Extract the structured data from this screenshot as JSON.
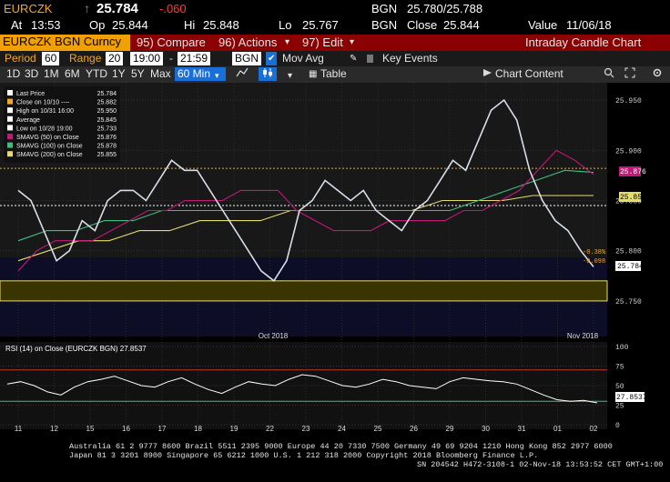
{
  "header": {
    "ticker": "EURCZK",
    "arrow": "↑",
    "last": "25.784",
    "change": "-.060",
    "at_label": "At",
    "at": "13:53",
    "op_label": "Op",
    "open": "25.844",
    "hi_label": "Hi",
    "high": "25.848",
    "lo_label": "Lo",
    "low": "25.767",
    "src1": "BGN",
    "bidask": "25.780/25.788",
    "src2": "BGN",
    "close_label": "Close",
    "close": "25.844",
    "value_label": "Value",
    "value_date": "11/06/18"
  },
  "toolbar": {
    "security": "EURCZK BGN Curncy",
    "compare": "95) Compare",
    "actions": "96) Actions",
    "edit": "97) Edit",
    "title": "Intraday Candle Chart"
  },
  "range_bar": {
    "period_label": "Period",
    "period": "60",
    "range_label": "Range",
    "range": "20",
    "from": "19:00",
    "dash": "-",
    "to": "21:59",
    "source": "BGN",
    "mov_avg": "Mov Avg",
    "key_events": "Key Events"
  },
  "tabs": {
    "items": [
      "1D",
      "3D",
      "1M",
      "6M",
      "YTD",
      "1Y",
      "5Y",
      "Max"
    ],
    "interval": "60 Min",
    "table": "Table",
    "chart_content": "Chart Content"
  },
  "legend": {
    "items": [
      {
        "label": "Last Price",
        "value": "25.784",
        "color": "#ffffff"
      },
      {
        "label": "Close on 10/10 ----",
        "value": "25.882",
        "color": "#f5a623"
      },
      {
        "label": "High on 10/31 16:00",
        "value": "25.950",
        "color": "#ffffff"
      },
      {
        "label": "Average",
        "value": "25.845",
        "color": "#ffffff"
      },
      {
        "label": "Low on 10/28 19:00",
        "value": "25.733",
        "color": "#ffffff"
      },
      {
        "label": "SMAVG (50)  on Close",
        "value": "25.876",
        "color": "#c2187a"
      },
      {
        "label": "SMAVG (100) on Close",
        "value": "25.878",
        "color": "#3fbf7f"
      },
      {
        "label": "SMAVG (200) on Close",
        "value": "25.855",
        "color": "#e6dc6e"
      }
    ],
    "rsi": "RSI (14)  on Close (EURCZK BGN) 27.8537"
  },
  "annotations": {
    "pct": "-0.38%",
    "chg": "-0.098",
    "price_last": "25.784",
    "price_50": "25.876",
    "price_200": "25.855",
    "rsi_last": "27.8537"
  },
  "footer": {
    "line1": "Australia 61 2 9777 8600 Brazil 5511 2395 9000 Europe 44 20 7330 7500 Germany 49 69 9204 1210 Hong Kong 852 2977 6000",
    "line2": "Japan 81 3 3201 8900        Singapore 65 6212 1000        U.S. 1 212 318 2000            Copyright 2018 Bloomberg Finance L.P.",
    "line3": "SN 204542 H472-3108-1 02-Nov-18 13:53:52 CET  GMT+1:00"
  },
  "chart_data": [
    {
      "type": "line",
      "title": "Intraday Candle Chart",
      "x_labels": [
        "11",
        "12",
        "15",
        "16",
        "17",
        "18",
        "19",
        "22",
        "23",
        "24",
        "25",
        "26",
        "29",
        "30",
        "31",
        "01",
        "02"
      ],
      "x_group_labels": [
        "Oct 2018",
        "Nov 2018"
      ],
      "ylim": [
        25.73,
        25.96
      ],
      "y_ticks": [
        25.75,
        25.8,
        25.85,
        25.9,
        25.95
      ],
      "y_tick_labels": [
        "25.750",
        "25.800",
        "25.850",
        "25.900",
        "25.950"
      ],
      "series": [
        {
          "name": "Last Price",
          "color": "#d8dee8",
          "values": [
            25.86,
            25.85,
            25.82,
            25.79,
            25.8,
            25.83,
            25.82,
            25.85,
            25.86,
            25.86,
            25.85,
            25.87,
            25.89,
            25.88,
            25.88,
            25.86,
            25.84,
            25.82,
            25.8,
            25.78,
            25.77,
            25.79,
            25.84,
            25.85,
            25.87,
            25.86,
            25.85,
            25.86,
            25.84,
            25.83,
            25.82,
            25.84,
            25.85,
            25.87,
            25.89,
            25.88,
            25.91,
            25.94,
            25.95,
            25.93,
            25.88,
            25.85,
            25.83,
            25.82,
            25.8,
            25.784
          ]
        },
        {
          "name": "SMAVG (50)",
          "color": "#c2187a",
          "values": [
            25.78,
            25.8,
            25.81,
            25.81,
            25.81,
            25.82,
            25.83,
            25.84,
            25.84,
            25.85,
            25.85,
            25.85,
            25.86,
            25.86,
            25.86,
            25.84,
            25.83,
            25.82,
            25.82,
            25.82,
            25.83,
            25.83,
            25.83,
            25.83,
            25.84,
            25.84,
            25.85,
            25.86,
            25.88,
            25.9,
            25.89,
            25.876
          ]
        },
        {
          "name": "SMAVG (100)",
          "color": "#3fbf7f",
          "values": [
            25.81,
            25.82,
            25.82,
            25.83,
            25.83,
            25.84,
            25.84,
            25.84,
            25.84,
            25.84,
            25.84,
            25.84,
            25.84,
            25.84,
            25.84,
            25.84,
            25.85,
            25.86,
            25.87,
            25.88,
            25.878
          ]
        },
        {
          "name": "SMAVG (200)",
          "color": "#e6dc6e",
          "values": [
            25.79,
            25.8,
            25.81,
            25.81,
            25.82,
            25.82,
            25.83,
            25.83,
            25.83,
            25.84,
            25.84,
            25.84,
            25.84,
            25.84,
            25.85,
            25.85,
            25.85,
            25.855,
            25.855,
            25.855
          ]
        }
      ],
      "reference_lines": [
        {
          "name": "Close on 10/10",
          "value": 25.882,
          "color": "#f5a623"
        },
        {
          "name": "Average",
          "value": 25.845,
          "color": "#ffffff"
        }
      ],
      "band": {
        "from": 25.75,
        "to": 25.77,
        "color": "#e6dc6e"
      }
    },
    {
      "type": "line",
      "title": "RSI (14)",
      "ylim": [
        0,
        100
      ],
      "y_ticks": [
        0,
        25,
        50,
        75,
        100
      ],
      "y_tick_labels": [
        "0",
        "25",
        "50",
        "75",
        "100"
      ],
      "reference_lines": [
        {
          "value": 70,
          "color": "#c0392b"
        },
        {
          "value": 30,
          "color": "#3fbf7f"
        }
      ],
      "series": [
        {
          "name": "RSI (14)",
          "color": "#ffffff",
          "values": [
            52,
            55,
            50,
            42,
            38,
            48,
            55,
            58,
            62,
            56,
            50,
            48,
            55,
            60,
            52,
            45,
            40,
            48,
            55,
            52,
            50,
            58,
            64,
            62,
            56,
            50,
            48,
            52,
            58,
            55,
            50,
            48,
            46,
            55,
            60,
            58,
            56,
            55,
            52,
            45,
            38,
            32,
            30,
            31,
            27.8537
          ]
        }
      ]
    }
  ]
}
